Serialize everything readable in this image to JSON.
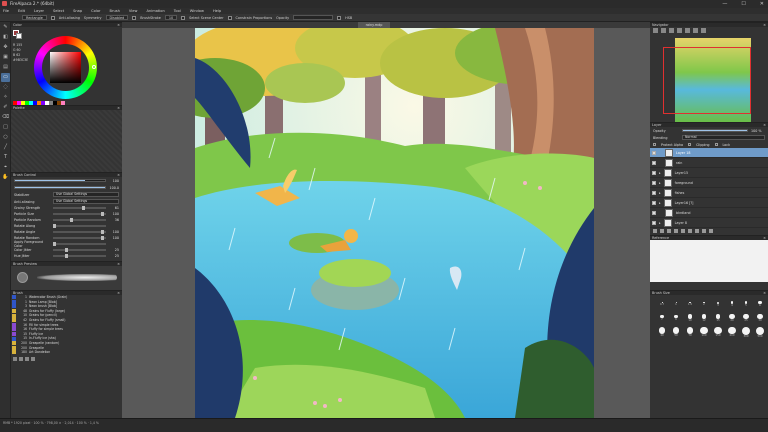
{
  "app": {
    "title": "FireAlpaca 2.* (64bit)",
    "window_controls": [
      "—",
      "☐",
      "✕"
    ]
  },
  "menu": [
    "File",
    "Edit",
    "Layer",
    "Select",
    "Snap",
    "Color",
    "Brush",
    "View",
    "Animation",
    "Tool",
    "Window",
    "Help"
  ],
  "options": {
    "mode": "Rectangle",
    "anti_alias_label": "Anti-aliasing",
    "symmetry_label": "Symmetry",
    "symmetry_value": "Disabled",
    "brushstroke_label": "BrushStroke",
    "brushstroke_value": "10",
    "snap_label": "Select Scene Center",
    "constraint_label": "Constrain Proportions",
    "opacity_label": "Opacity",
    "hsb": "HSB"
  },
  "panels": {
    "color": "Color",
    "palette": "Palette",
    "brush_control": "Brush Control",
    "brush_preview": "Brush Preview",
    "brush": "Brush",
    "navigator": "Navigator",
    "layer": "Layer",
    "reference": "Reference",
    "brush_size": "Brush Size"
  },
  "color": {
    "hex": "#9B3C3E",
    "rgb": [
      "R 155",
      "G 60",
      "B 62"
    ]
  },
  "palette_colors": [
    "#ff0000",
    "#ff00ff",
    "#ffff00",
    "#00ff00",
    "#00ffff",
    "#0000ff",
    "#ff8000",
    "#8000ff",
    "#ffffff",
    "#808080",
    "#000000",
    "#804000",
    "#ff80c0"
  ],
  "brush_control": {
    "size_value": "100",
    "opacity_value": "100.0",
    "stabilizer_label": "Stabilizer",
    "stabilizer_value": "Use Global Settings",
    "aa_label": "Anti-aliasing",
    "aa_value": "Use Global Settings",
    "params": [
      {
        "label": "Grainy Strength",
        "value": "61",
        "knob": 0.6
      },
      {
        "label": "Particle Size",
        "value": "100",
        "knob": 1.0
      },
      {
        "label": "Particle Random",
        "value": "36",
        "knob": 0.36
      },
      {
        "label": "Rotate Along",
        "value": "",
        "knob": 0.0
      },
      {
        "label": "Rotate Angle",
        "value": "100",
        "knob": 1.0
      },
      {
        "label": "Rotate Random",
        "value": "100",
        "knob": 1.0
      },
      {
        "label": "Apply Foreground Color",
        "value": "",
        "knob": 0.0
      },
      {
        "label": "Color Jitter",
        "value": "25",
        "knob": 0.25
      },
      {
        "label": "Hue Jitter",
        "value": "25",
        "knob": 0.25
      }
    ]
  },
  "brushes": [
    {
      "n": "1",
      "name": "Watercolor Brush (Grain)",
      "color": "#2f55c8"
    },
    {
      "n": "1",
      "name": "Neon Lamp [Blob]",
      "color": "#2f55c8"
    },
    {
      "n": "3",
      "name": "Neon brush [Blob]",
      "color": "#2f55c8"
    },
    {
      "n": "48",
      "name": "Grains for Fluffy (large)",
      "color": "#d7b23c"
    },
    {
      "n": "10",
      "name": "Grains for (pencil)",
      "color": "#d7b23c"
    },
    {
      "n": "42",
      "name": "Grains for Fluffy (small)",
      "color": "#d7b23c"
    },
    {
      "n": "16",
      "name": "Fill for simple trees",
      "color": "#8a4ad0"
    },
    {
      "n": "16",
      "name": "Fluffy for simple trees",
      "color": "#8a4ad0"
    },
    {
      "n": "15",
      "name": "Fluffy ice",
      "color": "#8a4ad0"
    },
    {
      "n": "15",
      "name": "In-Fluffy ice (sha)",
      "color": "#2f55c8"
    },
    {
      "n": "200",
      "name": "Greapelle (random)",
      "color": "#d7b23c"
    },
    {
      "n": "200",
      "name": "Greapelle",
      "color": "#d7b23c"
    },
    {
      "n": "180",
      "name": "Art Dandelion",
      "color": "#d7b23c"
    }
  ],
  "layer": {
    "opacity_label": "Opacity",
    "opacity_value": "100 %",
    "blending_label": "Blending",
    "blending_value": "Normal",
    "protect_alpha": "Protect Alpha",
    "clipping": "Clipping",
    "lock": "Lock",
    "rows": [
      {
        "name": "Layer 18",
        "active": true,
        "folder": false
      },
      {
        "name": "rain",
        "active": false,
        "folder": false
      },
      {
        "name": "Layer15",
        "active": false,
        "folder": true
      },
      {
        "name": "foreground",
        "active": false,
        "folder": true
      },
      {
        "name": "fishes",
        "active": false,
        "folder": true
      },
      {
        "name": "Layer16 [?]",
        "active": false,
        "folder": true
      },
      {
        "name": "bkrdland",
        "active": false,
        "folder": false
      },
      {
        "name": "Layer 8",
        "active": false,
        "folder": true
      }
    ]
  },
  "brush_sizes": [
    "0.7",
    "1",
    "1.5",
    "2",
    "3",
    "4",
    "5",
    "6",
    "7",
    "8",
    "10",
    "12",
    "15",
    "20",
    "25",
    "30",
    "40",
    "50",
    "70",
    "100",
    "150",
    "200",
    "300",
    "500"
  ],
  "canvas_tab": "rainy.mdp",
  "status": {
    "text": "RMB * 1920 pixel   ·   100 %   ·   798,00 ×   ·   2,014   ·   100 %   ·   1,4 %"
  },
  "colors": {
    "accent": "#4a6f9a",
    "layer_active": "#6f9bc9"
  }
}
